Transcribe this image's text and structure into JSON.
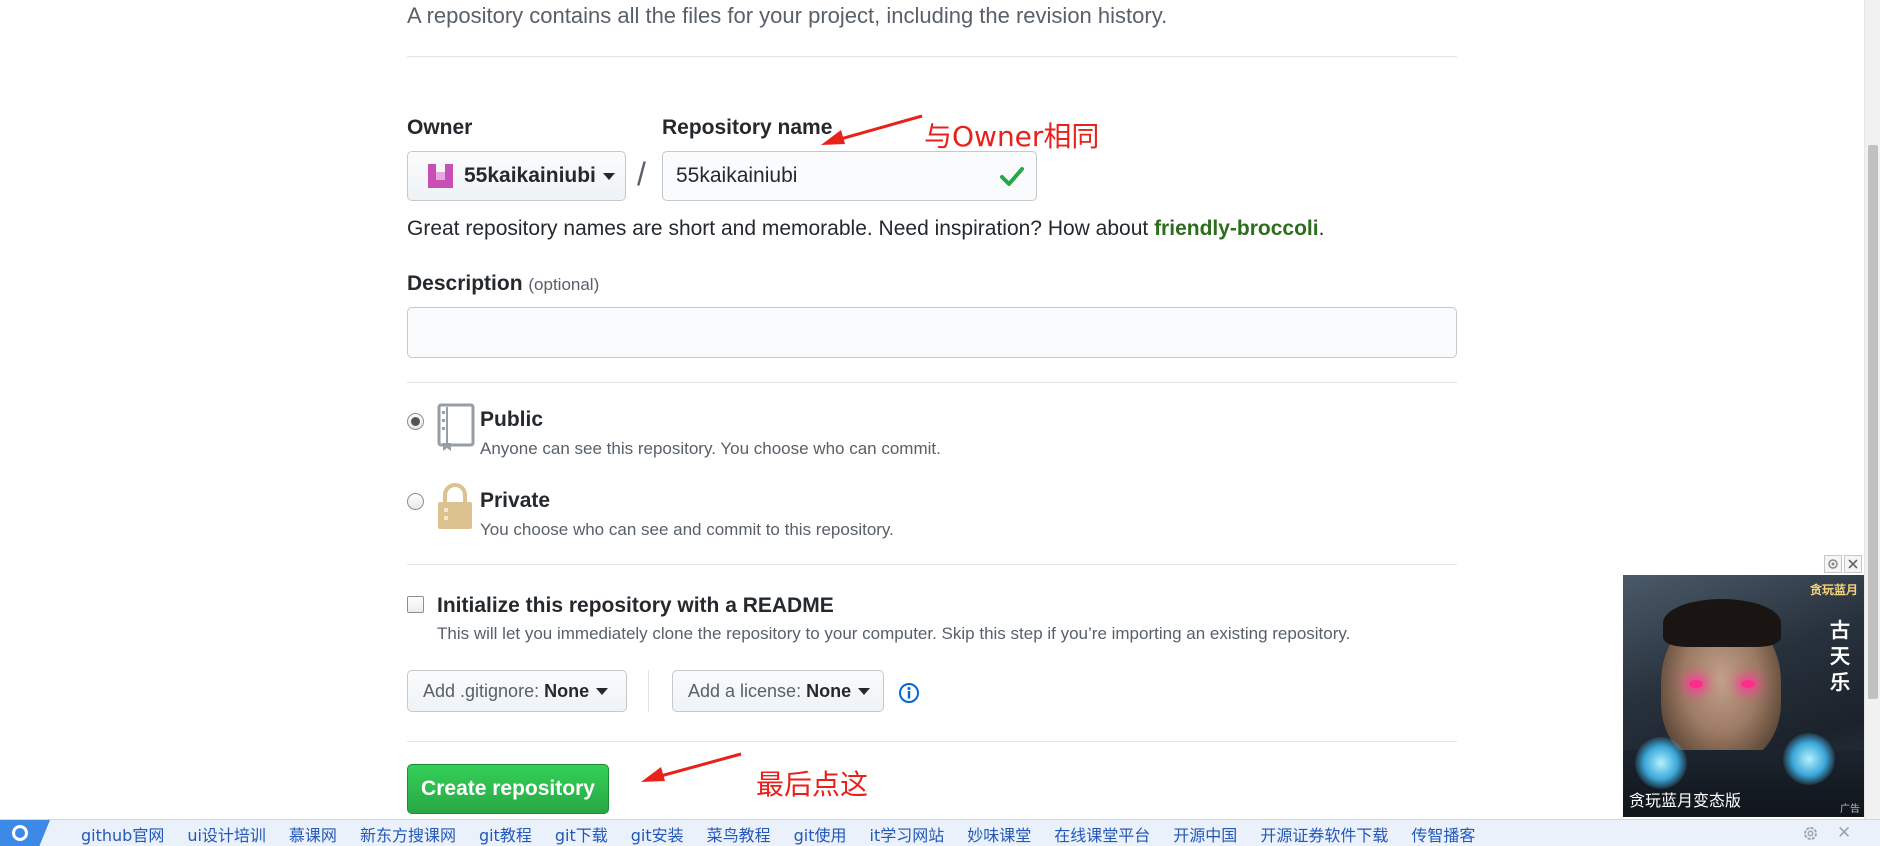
{
  "intro_text": "A repository contains all the files for your project, including the revision history.",
  "owner": {
    "label": "Owner",
    "name": "55kaikainiubi",
    "avatar_color": "#c94fb7"
  },
  "repo": {
    "label": "Repository name",
    "value": "55kaikainiubi",
    "valid_color": "#28a745"
  },
  "hint": {
    "text": "Great repository names are short and memorable. Need inspiration? How about ",
    "suggestion": "friendly-broccoli",
    "period": "."
  },
  "description": {
    "label": "Description",
    "optional": "(optional)",
    "value": ""
  },
  "visibility": {
    "selected": "public",
    "public": {
      "title": "Public",
      "desc": "Anyone can see this repository. You choose who can commit."
    },
    "private": {
      "title": "Private",
      "desc": "You choose who can see and commit to this repository."
    }
  },
  "readme": {
    "title": "Initialize this repository with a README",
    "desc": "This will let you immediately clone the repository to your computer. Skip this step if you’re importing an existing repository.",
    "checked": false
  },
  "gitignore": {
    "label": "Add .gitignore:",
    "value": "None"
  },
  "license": {
    "label": "Add a license:",
    "value": "None"
  },
  "create_button": "Create repository",
  "annotations": {
    "same_as_owner": "与Owner相同",
    "click_last": "最后点这",
    "color": "#e8221b"
  },
  "ad": {
    "logo": "贪玩蓝月",
    "vertical_text": "古天乐",
    "caption": "贪玩蓝月变态版",
    "tag": "广告"
  },
  "bottom_links": [
    "github官网",
    "ui设计培训",
    "慕课网",
    "新东方搜课网",
    "git教程",
    "git下载",
    "git安装",
    "菜鸟教程",
    "git使用",
    "it学习网站",
    "妙味课堂",
    "在线课堂平台",
    "开源中国",
    "开源证券软件下载",
    "传智播客"
  ],
  "icons": {
    "public": "repo-book-icon",
    "private": "lock-icon",
    "valid": "check-icon",
    "info": "info-icon"
  }
}
